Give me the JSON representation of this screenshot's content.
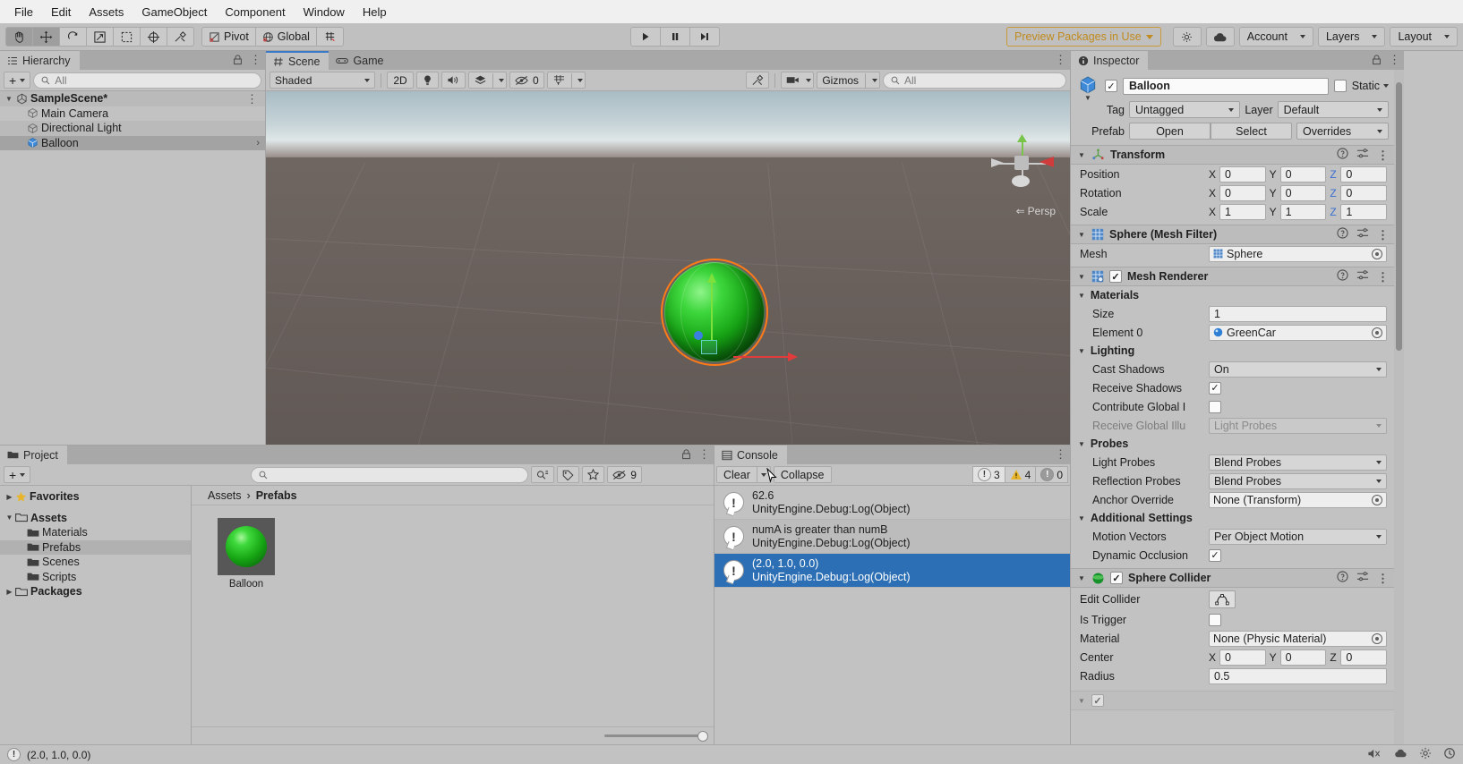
{
  "menubar": {
    "items": [
      "File",
      "Edit",
      "Assets",
      "GameObject",
      "Component",
      "Window",
      "Help"
    ]
  },
  "toolbar": {
    "tools": [
      "hand-tool",
      "move-tool",
      "rotate-tool",
      "scale-tool",
      "rect-tool",
      "transform-tool",
      "custom-tool"
    ],
    "pivot_label": "Pivot",
    "global_label": "Global",
    "grid_snap_label": "grid-snapping",
    "play_label": "play",
    "pause_label": "pause",
    "step_label": "step",
    "preview_packages": "Preview Packages in Use",
    "account_label": "Account",
    "layers_label": "Layers",
    "layout_label": "Layout",
    "accent_orange": "#c08a1e",
    "accent_blue": "#3a78c8"
  },
  "hierarchy": {
    "tab_label": "Hierarchy",
    "search_placeholder": "All",
    "add_label": "+",
    "items": [
      {
        "label": "SampleScene*",
        "depth": 0,
        "bold": true,
        "type": "scene"
      },
      {
        "label": "Main Camera",
        "depth": 1,
        "bold": false,
        "type": "gameobject"
      },
      {
        "label": "Directional Light",
        "depth": 1,
        "bold": false,
        "type": "gameobject"
      },
      {
        "label": "Balloon",
        "depth": 1,
        "bold": false,
        "type": "prefab",
        "selected": true
      }
    ]
  },
  "scene": {
    "tab_scene": "Scene",
    "tab_game": "Game",
    "shading_mode": "Shaded",
    "mode_2d": "2D",
    "hidden_count": "0",
    "gizmos_label": "Gizmos",
    "search_placeholder": "All",
    "perspective_label": "Persp",
    "gizmo_axes": {
      "x": "x",
      "y": "y",
      "z": "z"
    },
    "selected_object": "Balloon"
  },
  "project": {
    "tab_label": "Project",
    "search_placeholder": "",
    "hidden_count": "9",
    "tree": [
      {
        "label": "Favorites",
        "depth": 0,
        "bold": true,
        "icon": "star-icon",
        "twisty": "right"
      },
      {
        "label": "Assets",
        "depth": 0,
        "bold": true,
        "icon": "folder-icon",
        "twisty": "down"
      },
      {
        "label": "Materials",
        "depth": 1,
        "bold": false,
        "icon": "folder-icon"
      },
      {
        "label": "Prefabs",
        "depth": 1,
        "bold": false,
        "icon": "folder-icon",
        "selected": true
      },
      {
        "label": "Scenes",
        "depth": 1,
        "bold": false,
        "icon": "folder-icon"
      },
      {
        "label": "Scripts",
        "depth": 1,
        "bold": false,
        "icon": "folder-icon"
      },
      {
        "label": "Packages",
        "depth": 0,
        "bold": true,
        "icon": "folder-icon",
        "twisty": "right"
      }
    ],
    "breadcrumb": [
      "Assets",
      "Prefabs"
    ],
    "assets": [
      {
        "name": "Balloon",
        "type": "prefab-sphere"
      }
    ]
  },
  "console": {
    "tab_label": "Console",
    "clear_label": "Clear",
    "collapse_label": "Collapse",
    "counts": {
      "info": "3",
      "warning": "4",
      "error": "0"
    },
    "messages": [
      {
        "text": "62.6",
        "stack": "UnityEngine.Debug:Log(Object)",
        "type": "info",
        "selected": false
      },
      {
        "text": "numA is greater than numB",
        "stack": "UnityEngine.Debug:Log(Object)",
        "type": "info",
        "selected": false
      },
      {
        "text": "(2.0, 1.0, 0.0)",
        "stack": "UnityEngine.Debug:Log(Object)",
        "type": "info",
        "selected": true
      }
    ]
  },
  "inspector": {
    "tab_label": "Inspector",
    "object_name": "Balloon",
    "enabled": true,
    "static_label": "Static",
    "tag_label": "Tag",
    "tag_value": "Untagged",
    "layer_label": "Layer",
    "layer_value": "Default",
    "prefab_label": "Prefab",
    "prefab_open": "Open",
    "prefab_select": "Select",
    "prefab_overrides": "Overrides",
    "components": [
      {
        "title": "Transform",
        "icon": "transform-icon",
        "has_checkbox": false,
        "rows": [
          {
            "label": "Position",
            "kind": "vector3",
            "x": "0",
            "y": "0",
            "z": "0"
          },
          {
            "label": "Rotation",
            "kind": "vector3",
            "x": "0",
            "y": "0",
            "z": "0"
          },
          {
            "label": "Scale",
            "kind": "vector3",
            "x": "1",
            "y": "1",
            "z": "1"
          }
        ]
      },
      {
        "title": "Sphere (Mesh Filter)",
        "icon": "mesh-filter-icon",
        "has_checkbox": false,
        "rows": [
          {
            "label": "Mesh",
            "kind": "object",
            "value": "Sphere",
            "icon": "mesh-icon"
          }
        ]
      },
      {
        "title": "Mesh Renderer",
        "icon": "mesh-renderer-icon",
        "has_checkbox": true,
        "checked": true,
        "rows": [
          {
            "label": "Materials",
            "kind": "group"
          },
          {
            "label": "Size",
            "kind": "text",
            "value": "1",
            "indent": true
          },
          {
            "label": "Element 0",
            "kind": "object",
            "value": "GreenCar",
            "icon": "material-icon",
            "indent": true
          },
          {
            "label": "Lighting",
            "kind": "group"
          },
          {
            "label": "Cast Shadows",
            "kind": "dropdown",
            "value": "On",
            "indent": true
          },
          {
            "label": "Receive Shadows",
            "kind": "checkbox",
            "checked": true,
            "indent": true
          },
          {
            "label": "Contribute Global I",
            "kind": "checkbox",
            "checked": false,
            "indent": true
          },
          {
            "label": "Receive Global Illu",
            "kind": "dropdown",
            "value": "Light Probes",
            "indent": true,
            "disabled": true
          },
          {
            "label": "Probes",
            "kind": "group"
          },
          {
            "label": "Light Probes",
            "kind": "dropdown",
            "value": "Blend Probes",
            "indent": true
          },
          {
            "label": "Reflection Probes",
            "kind": "dropdown",
            "value": "Blend Probes",
            "indent": true
          },
          {
            "label": "Anchor Override",
            "kind": "object",
            "value": "None (Transform)",
            "indent": true
          },
          {
            "label": "Additional Settings",
            "kind": "group"
          },
          {
            "label": "Motion Vectors",
            "kind": "dropdown",
            "value": "Per Object Motion",
            "indent": true
          },
          {
            "label": "Dynamic Occlusion",
            "kind": "checkbox",
            "checked": true,
            "indent": true
          }
        ]
      },
      {
        "title": "Sphere Collider",
        "icon": "sphere-collider-icon",
        "has_checkbox": true,
        "checked": true,
        "rows": [
          {
            "label": "Edit Collider",
            "kind": "editcollider"
          },
          {
            "label": "Is Trigger",
            "kind": "checkbox",
            "checked": false
          },
          {
            "label": "Material",
            "kind": "object",
            "value": "None (Physic Material)"
          },
          {
            "label": "Center",
            "kind": "vector3",
            "x": "0",
            "y": "0",
            "z": "0"
          },
          {
            "label": "Radius",
            "kind": "text",
            "value": "0.5"
          }
        ]
      }
    ]
  },
  "statusbar": {
    "message": "(2.0, 1.0, 0.0)"
  }
}
